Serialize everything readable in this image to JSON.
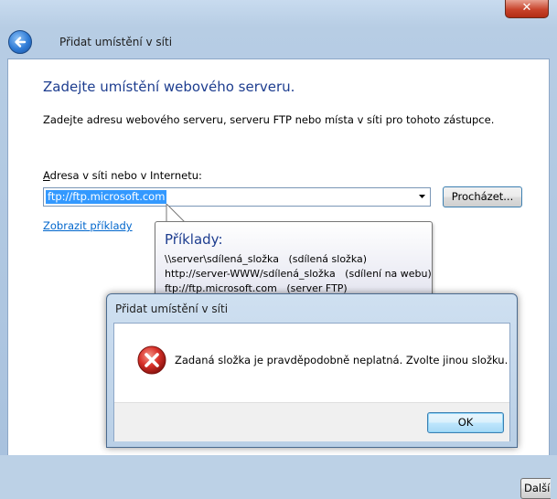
{
  "window": {
    "close_glyph": "✕"
  },
  "wizard": {
    "title": "Přidat umístění v síti",
    "heading": "Zadejte umístění webového serveru.",
    "description": "Zadejte adresu webového serveru, serveru FTP nebo místa v síti pro tohoto zástupce.",
    "address_label_accel": "A",
    "address_label_rest": "dresa v síti nebo v Internetu:",
    "address_value": "ftp://ftp.microsoft.com",
    "browse_label": "Procházet...",
    "examples_link": "Zobrazit příklady",
    "next_button_partial": "Další"
  },
  "tooltip": {
    "title": "Příklady:",
    "lines": [
      "\\\\server\\sdílená_složka   (sdílená složka)",
      "http://server-WWW/sdílená_složka   (sdílení na webu)",
      "ftp://ftp.microsoft.com   (server FTP)"
    ]
  },
  "dialog": {
    "title": "Přidat umístění v síti",
    "message": "Zadaná složka je pravděpodobně neplatná. Zvolte jinou složku.",
    "ok_label": "OK"
  },
  "colors": {
    "accent_blue": "#1d3d8f",
    "link_blue": "#0066cc",
    "selection": "#3399ff",
    "error_red": "#d9312a"
  },
  "icons": {
    "back": "back-arrow-icon",
    "dropdown": "chevron-down-icon",
    "error": "error-icon"
  }
}
